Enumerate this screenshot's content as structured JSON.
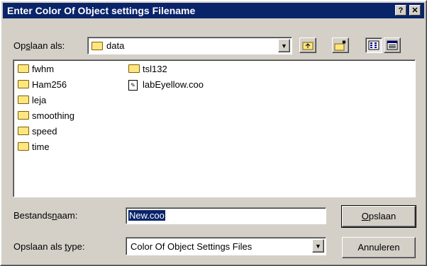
{
  "window": {
    "title": "Enter Color Of Object settings Filename",
    "help_label": "?",
    "close_label": "✕"
  },
  "save_in": {
    "label_pre": "Op",
    "label_u": "s",
    "label_post": "laan als:",
    "value": "data"
  },
  "toolbar": {
    "up_icon": "up-folder-icon",
    "new_folder_icon": "new-folder-icon",
    "list_view_icon": "list-view-icon",
    "details_view_icon": "details-view-icon"
  },
  "files": {
    "col1": [
      {
        "name": "fwhm",
        "type": "folder"
      },
      {
        "name": "Ham256",
        "type": "folder"
      },
      {
        "name": "leja",
        "type": "folder"
      },
      {
        "name": "smoothing",
        "type": "folder"
      },
      {
        "name": "speed",
        "type": "folder"
      },
      {
        "name": "time",
        "type": "folder"
      }
    ],
    "col2": [
      {
        "name": "tsl132",
        "type": "folder"
      },
      {
        "name": "labEyellow.coo",
        "type": "file"
      }
    ]
  },
  "filename": {
    "label_pre": "Bestands",
    "label_u": "n",
    "label_post": "aam:",
    "value": "New.coo"
  },
  "filetype": {
    "label_pre": "Opslaan als ",
    "label_u": "t",
    "label_post": "ype:",
    "value": "Color Of Object Settings Files"
  },
  "buttons": {
    "save_pre": "",
    "save_u": "O",
    "save_post": "pslaan",
    "cancel": "Annuleren"
  }
}
